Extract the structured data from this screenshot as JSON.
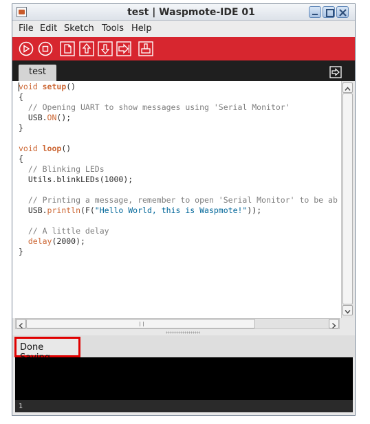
{
  "window": {
    "title": "test | Waspmote-IDE 01"
  },
  "menu": {
    "items": [
      "File",
      "Edit",
      "Sketch",
      "Tools",
      "Help"
    ]
  },
  "toolbar": {
    "buttons": [
      "verify-icon",
      "stop-icon",
      "new-icon",
      "open-icon",
      "save-icon",
      "upload-icon",
      "serial-icon"
    ],
    "accent_color": "#d7262f"
  },
  "tabs": [
    {
      "label": "test"
    }
  ],
  "editor": {
    "lines": [
      [
        [
          "kw",
          "void "
        ],
        [
          "fn",
          "setup"
        ],
        [
          "",
          "()"
        ]
      ],
      [
        [
          "",
          "{"
        ]
      ],
      [
        [
          "cm",
          "  // Opening UART to show messages using 'Serial Monitor'"
        ]
      ],
      [
        [
          "",
          "  USB."
        ],
        [
          "meth",
          "ON"
        ],
        [
          "",
          "();"
        ]
      ],
      [
        [
          "",
          "}"
        ]
      ],
      [
        [
          "",
          ""
        ]
      ],
      [
        [
          "kw",
          "void "
        ],
        [
          "fn",
          "loop"
        ],
        [
          "",
          "()"
        ]
      ],
      [
        [
          "",
          "{"
        ]
      ],
      [
        [
          "cm",
          "  // Blinking LEDs"
        ]
      ],
      [
        [
          "",
          "  Utils.blinkLEDs(1000);"
        ]
      ],
      [
        [
          "",
          ""
        ]
      ],
      [
        [
          "cm",
          "  // Printing a message, remember to open 'Serial Monitor' to be ab"
        ]
      ],
      [
        [
          "",
          "  USB."
        ],
        [
          "meth",
          "println"
        ],
        [
          "",
          "(F("
        ],
        [
          "str",
          "\"Hello World, this is Waspmote!\""
        ],
        [
          "",
          "));"
        ]
      ],
      [
        [
          "",
          ""
        ]
      ],
      [
        [
          "cm",
          "  // A little delay"
        ]
      ],
      [
        [
          "",
          "  "
        ],
        [
          "meth",
          "delay"
        ],
        [
          "",
          "(2000);"
        ]
      ],
      [
        [
          "",
          "}"
        ]
      ]
    ]
  },
  "status": {
    "message": "Done Saving."
  },
  "line_number": "1"
}
